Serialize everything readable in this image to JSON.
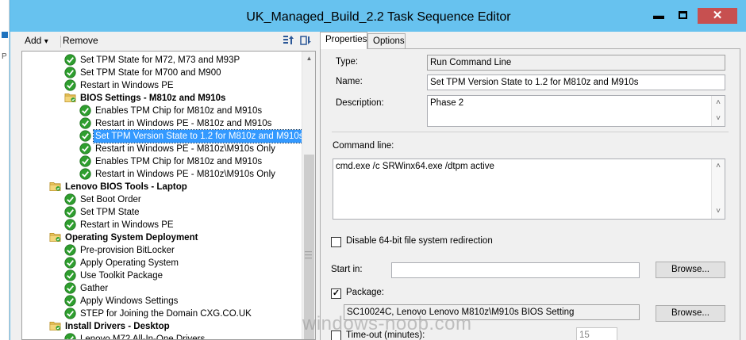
{
  "window": {
    "title": "UK_Managed_Build_2.2 Task Sequence Editor",
    "controls": {
      "minimize": "▬",
      "close": "✕"
    }
  },
  "toolbar": {
    "add_label": "Add",
    "add_arrow": "▾",
    "remove_label": "Remove"
  },
  "tree": {
    "items": [
      {
        "label": "Set TPM State for M72, M73 and M93P",
        "type": "step"
      },
      {
        "label": "Set TPM State for M700 and M900",
        "type": "step"
      },
      {
        "label": "Restart in Windows PE",
        "type": "step"
      },
      {
        "label": "BIOS Settings - M810z and M910s",
        "type": "group"
      },
      {
        "label": "Enables TPM Chip for M810z and M910s",
        "type": "step"
      },
      {
        "label": "Restart in Windows PE - M810z and M910s",
        "type": "step"
      },
      {
        "label": "Set TPM Version State to 1.2 for M810z and M910s",
        "type": "step",
        "selected": true
      },
      {
        "label": "Restart in Windows PE - M810z\\M910s Only",
        "type": "step"
      },
      {
        "label": "Enables TPM Chip for M810z and M910s",
        "type": "step"
      },
      {
        "label": "Restart in Windows PE - M810z\\M910s Only",
        "type": "step"
      },
      {
        "label": "Lenovo BIOS Tools - Laptop",
        "type": "group"
      },
      {
        "label": "Set Boot Order",
        "type": "step"
      },
      {
        "label": "Set TPM State",
        "type": "step"
      },
      {
        "label": "Restart in Windows PE",
        "type": "step"
      },
      {
        "label": "Operating System Deployment",
        "type": "group"
      },
      {
        "label": "Pre-provision BitLocker",
        "type": "step"
      },
      {
        "label": "Apply Operating System",
        "type": "step"
      },
      {
        "label": "Use Toolkit Package",
        "type": "step"
      },
      {
        "label": "Gather",
        "type": "step"
      },
      {
        "label": "Apply Windows Settings",
        "type": "step"
      },
      {
        "label": "STEP for Joining the Domain CXG.CO.UK",
        "type": "step"
      },
      {
        "label": "Install Drivers - Desktop",
        "type": "group"
      },
      {
        "label": "Lenovo M72 All-In-One Drivers",
        "type": "step"
      }
    ]
  },
  "tabs": [
    {
      "label": "Properties",
      "active": true
    },
    {
      "label": "Options",
      "active": false
    }
  ],
  "properties": {
    "type_label": "Type:",
    "type_value": "Run Command Line",
    "name_label": "Name:",
    "name_value": "Set TPM Version State to 1.2 for M810z and M910s",
    "description_label": "Description:",
    "description_value": "Phase 2",
    "command_line_label": "Command line:",
    "command_line_value": "cmd.exe /c SRWinx64.exe /dtpm active",
    "disable_redirection_label": "Disable 64-bit file system redirection",
    "disable_redirection_checked": false,
    "start_in_label": "Start in:",
    "start_in_value": "",
    "browse_label": "Browse...",
    "package_label": "Package:",
    "package_checked": true,
    "package_value": "SC10024C, Lenovo Lenovo M810z\\M910s BIOS Setting",
    "timeout_label": "Time-out (minutes):",
    "timeout_checked": false,
    "timeout_value": "15"
  },
  "watermark": "windows-noob.com",
  "colors": {
    "titlebar": "#67c2ef",
    "selection": "#3399ff",
    "close_button": "#c75050",
    "step_check": "#2e9e2e",
    "group_folder": "#e8c25a"
  }
}
